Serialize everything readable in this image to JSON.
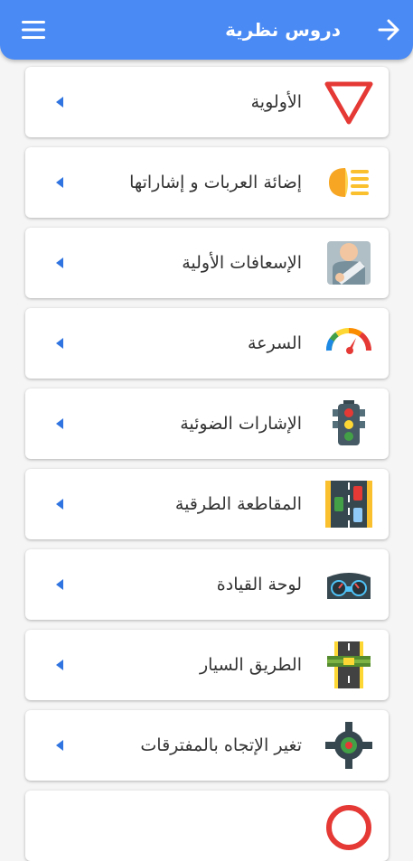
{
  "header": {
    "title": "دروس نظرية",
    "back_icon": "arrow-back-icon",
    "menu_icon": "hamburger-menu-icon",
    "color": "#4a8af4"
  },
  "lessons": [
    {
      "label": "الأولوية",
      "icon": "yield-sign-icon"
    },
    {
      "label": "إضائة العربات و إشاراتها",
      "icon": "headlight-icon"
    },
    {
      "label": "الإسعافات الأولية",
      "icon": "first-aid-icon"
    },
    {
      "label": "السرعة",
      "icon": "speedometer-icon"
    },
    {
      "label": "الإشارات الضوئية",
      "icon": "traffic-light-icon"
    },
    {
      "label": "المقاطعة الطرقية",
      "icon": "road-lanes-icon"
    },
    {
      "label": "لوحة القيادة",
      "icon": "dashboard-icon"
    },
    {
      "label": "الطريق السيار",
      "icon": "highway-icon"
    },
    {
      "label": "تغير الإتجاه بالمفترقات",
      "icon": "roundabout-icon"
    },
    {
      "label": "",
      "icon": "prohibition-sign-icon"
    }
  ]
}
